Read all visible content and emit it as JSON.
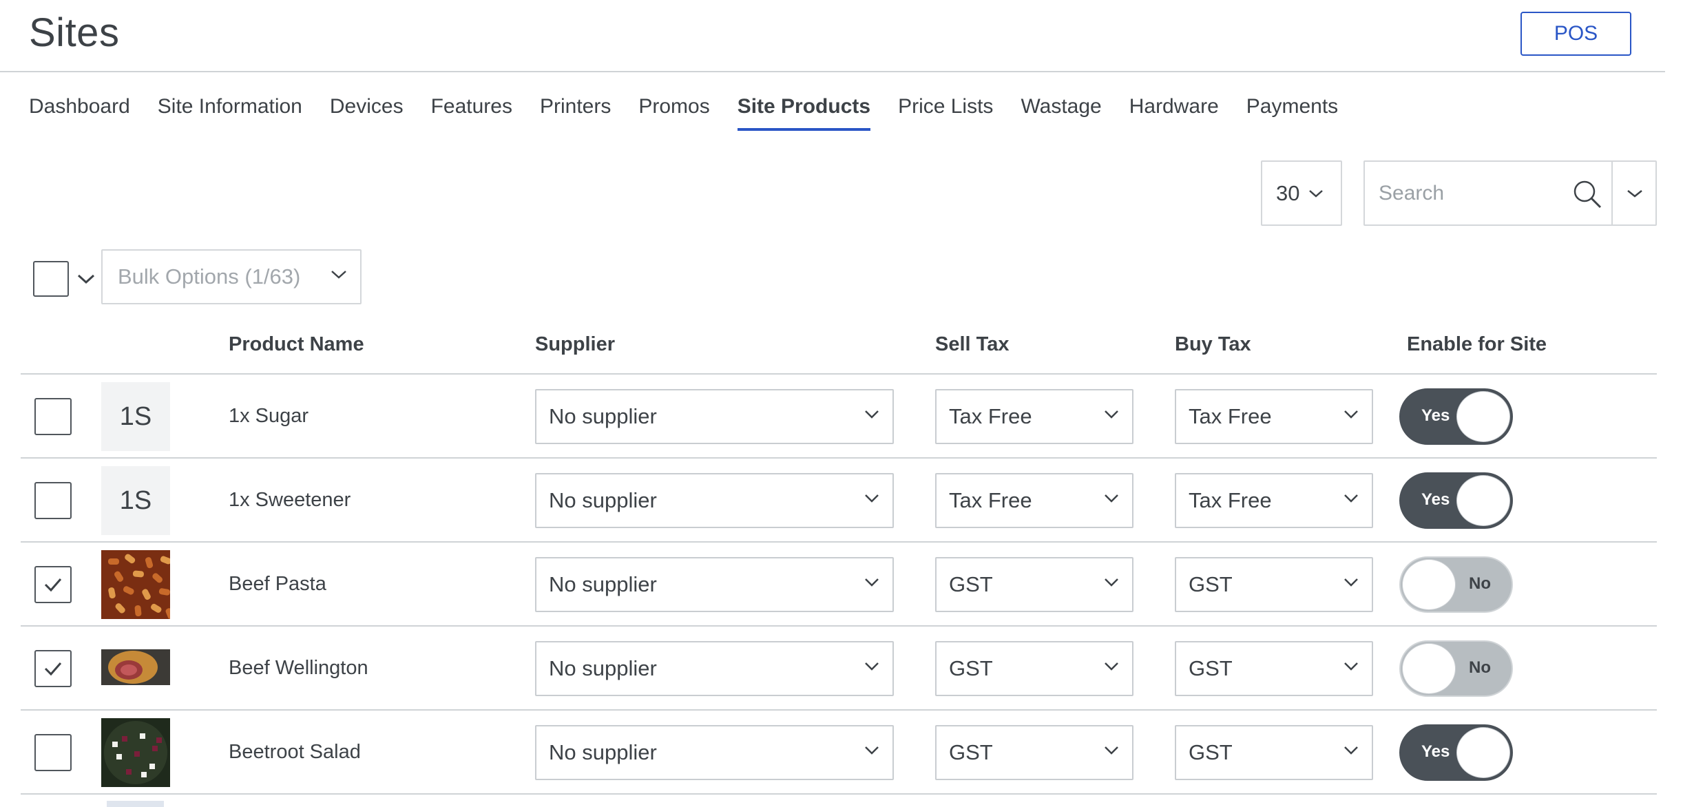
{
  "header": {
    "title": "Sites",
    "pos_label": "POS"
  },
  "tabs": [
    {
      "label": "Dashboard",
      "active": false
    },
    {
      "label": "Site Information",
      "active": false
    },
    {
      "label": "Devices",
      "active": false
    },
    {
      "label": "Features",
      "active": false
    },
    {
      "label": "Printers",
      "active": false
    },
    {
      "label": "Promos",
      "active": false
    },
    {
      "label": "Site Products",
      "active": true
    },
    {
      "label": "Price Lists",
      "active": false
    },
    {
      "label": "Wastage",
      "active": false
    },
    {
      "label": "Hardware",
      "active": false
    },
    {
      "label": "Payments",
      "active": false
    }
  ],
  "controls": {
    "per_page": "30",
    "search_placeholder": "Search",
    "bulk_options": "Bulk Options (1/63)"
  },
  "table": {
    "columns": {
      "product_name": "Product Name",
      "supplier": "Supplier",
      "sell_tax": "Sell Tax",
      "buy_tax": "Buy Tax",
      "enable": "Enable for Site"
    },
    "rows": [
      {
        "checked": false,
        "thumb": "1S",
        "thumb_kind": "initials",
        "name": "1x Sugar",
        "supplier": "No supplier",
        "sell_tax": "Tax Free",
        "buy_tax": "Tax Free",
        "enabled": true,
        "toggle_label": "Yes"
      },
      {
        "checked": false,
        "thumb": "1S",
        "thumb_kind": "initials",
        "name": "1x Sweetener",
        "supplier": "No supplier",
        "sell_tax": "Tax Free",
        "buy_tax": "Tax Free",
        "enabled": true,
        "toggle_label": "Yes"
      },
      {
        "checked": true,
        "thumb": "pasta-photo",
        "thumb_kind": "photo",
        "name": "Beef Pasta",
        "supplier": "No supplier",
        "sell_tax": "GST",
        "buy_tax": "GST",
        "enabled": false,
        "toggle_label": "No"
      },
      {
        "checked": true,
        "thumb": "wellington-photo",
        "thumb_kind": "photo",
        "name": "Beef Wellington",
        "supplier": "No supplier",
        "sell_tax": "GST",
        "buy_tax": "GST",
        "enabled": false,
        "toggle_label": "No"
      },
      {
        "checked": false,
        "thumb": "salad-photo",
        "thumb_kind": "photo",
        "name": "Beetroot Salad",
        "supplier": "No supplier",
        "sell_tax": "GST",
        "buy_tax": "GST",
        "enabled": true,
        "toggle_label": "Yes"
      }
    ]
  },
  "colors": {
    "accent": "#2a56c6",
    "text": "#3d4247",
    "toggle_on": "#4a5158",
    "toggle_off": "#b7bdc1"
  }
}
